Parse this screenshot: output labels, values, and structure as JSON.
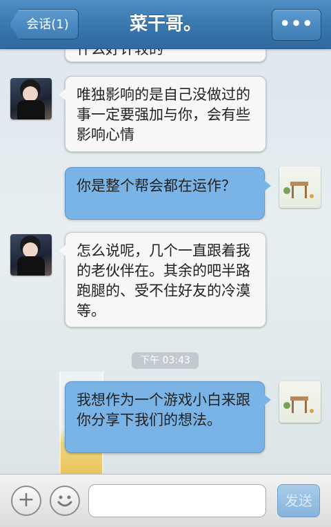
{
  "header": {
    "back_label": "会话(1)",
    "title": "菜干哥。",
    "more_label": "•••"
  },
  "messages": [
    {
      "side": "in",
      "text": "什么好计较的"
    },
    {
      "side": "in",
      "text": "唯独影响的是自己没做过的事一定要强加与你，会有些影响心情"
    },
    {
      "side": "out",
      "text": "你是整个帮会都在运作？"
    },
    {
      "side": "in",
      "text": "怎么说呢，几个一直跟着我的老伙伴在。其余的吧半路跑腿的、受不住好友的冷漠等。"
    },
    {
      "side": "out",
      "text": "我想作为一个游戏小白来跟你分享下我们的想法。"
    }
  ],
  "timestamp": "下午 03:43",
  "input": {
    "placeholder": "",
    "value": ""
  },
  "send_label": "发送",
  "colors": {
    "header": "#3876ad",
    "outgoing_bubble": "#7ab4e6",
    "incoming_bubble": "#f7f7f7"
  }
}
